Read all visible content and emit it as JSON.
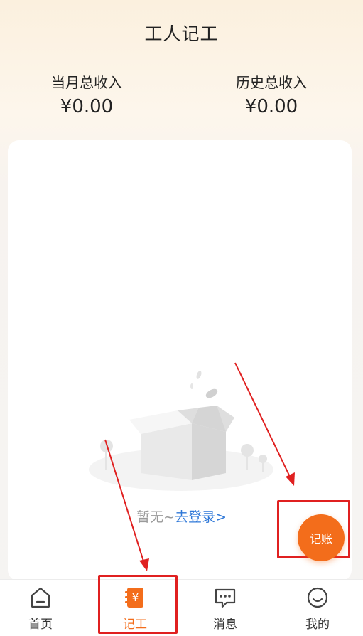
{
  "header": {
    "title": "工人记工"
  },
  "stats": {
    "month_label": "当月总收入",
    "month_value": "¥0.00",
    "history_label": "历史总收入",
    "history_value": "¥0.00"
  },
  "empty_state": {
    "prefix": "暂无~",
    "link": "去登录>"
  },
  "fab": {
    "label": "记账",
    "color": "#f36d1b"
  },
  "tabs": [
    {
      "label": "首页",
      "icon": "home-icon"
    },
    {
      "label": "记工",
      "icon": "ledger-yuan-icon",
      "active": true
    },
    {
      "label": "消息",
      "icon": "message-icon"
    },
    {
      "label": "我的",
      "icon": "profile-icon"
    }
  ],
  "colors": {
    "accent": "#f36d1b",
    "link": "#2f78d8",
    "highlight": "#e02020"
  }
}
